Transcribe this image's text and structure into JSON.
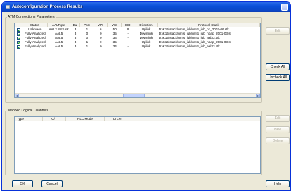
{
  "window": {
    "title": "Autoconfiguration Process Results"
  },
  "atm_group": {
    "label": "ATM Connections Parameters",
    "columns": [
      "Status",
      "AALType",
      "Bu",
      "Port",
      "VPI",
      "VCI",
      "CID",
      "Direction",
      "Protocol Stack"
    ],
    "rows": [
      {
        "checked": true,
        "status": "Unknown",
        "aaltype": "AAL2 SSSAR",
        "bu": "3",
        "port": "1",
        "vpi": "6",
        "vci": "50",
        "cid": "9",
        "direction": "Uplink",
        "stack": "D:\\K15\\stack\\umts_iub\\umts_iub_nc_2002-06.stk"
      },
      {
        "checked": true,
        "status": "Fully Analyzed",
        "aaltype": "AAL5",
        "bu": "3",
        "port": "0",
        "vpi": "0",
        "vci": "35",
        "cid": "-",
        "direction": "Downlink",
        "stack": "D:\\K15\\stack\\umts_iub\\umts_iub_nbap_2001-03.st"
      },
      {
        "checked": true,
        "status": "Fully Analyzed",
        "aaltype": "AAL5",
        "bu": "3",
        "port": "0",
        "vpi": "0",
        "vci": "34",
        "cid": "-",
        "direction": "Downlink",
        "stack": "D:\\K15\\stack\\umts_iub\\umts_iub_aal33.stk"
      },
      {
        "checked": true,
        "status": "Fully Analyzed",
        "aaltype": "AAL5",
        "bu": "3",
        "port": "1",
        "vpi": "0",
        "vci": "35",
        "cid": "-",
        "direction": "Uplink",
        "stack": "D:\\K15\\stack\\umts_iub\\umts_iub_nbap_2001-03.st"
      },
      {
        "checked": true,
        "status": "Fully Analyzed",
        "aaltype": "AAL5",
        "bu": "3",
        "port": "1",
        "vpi": "0",
        "vci": "34",
        "cid": "-",
        "direction": "Uplink",
        "stack": "D:\\K15\\stack\\umts_iub\\umts_iub_aal33.stk"
      }
    ],
    "buttons": {
      "edit": "Edit",
      "check_all": "Check All",
      "uncheck_all": "Uncheck All"
    }
  },
  "mapped_group": {
    "label": "Mapped Logical Channels",
    "columns": [
      "Type",
      "C/T",
      "RLC Mode",
      "LI Len"
    ],
    "buttons": {
      "edit": "Edit",
      "new": "New",
      "delete": "Delete"
    }
  },
  "footer": {
    "ok": "OK",
    "cancel": "Cancel",
    "help": "Help"
  }
}
